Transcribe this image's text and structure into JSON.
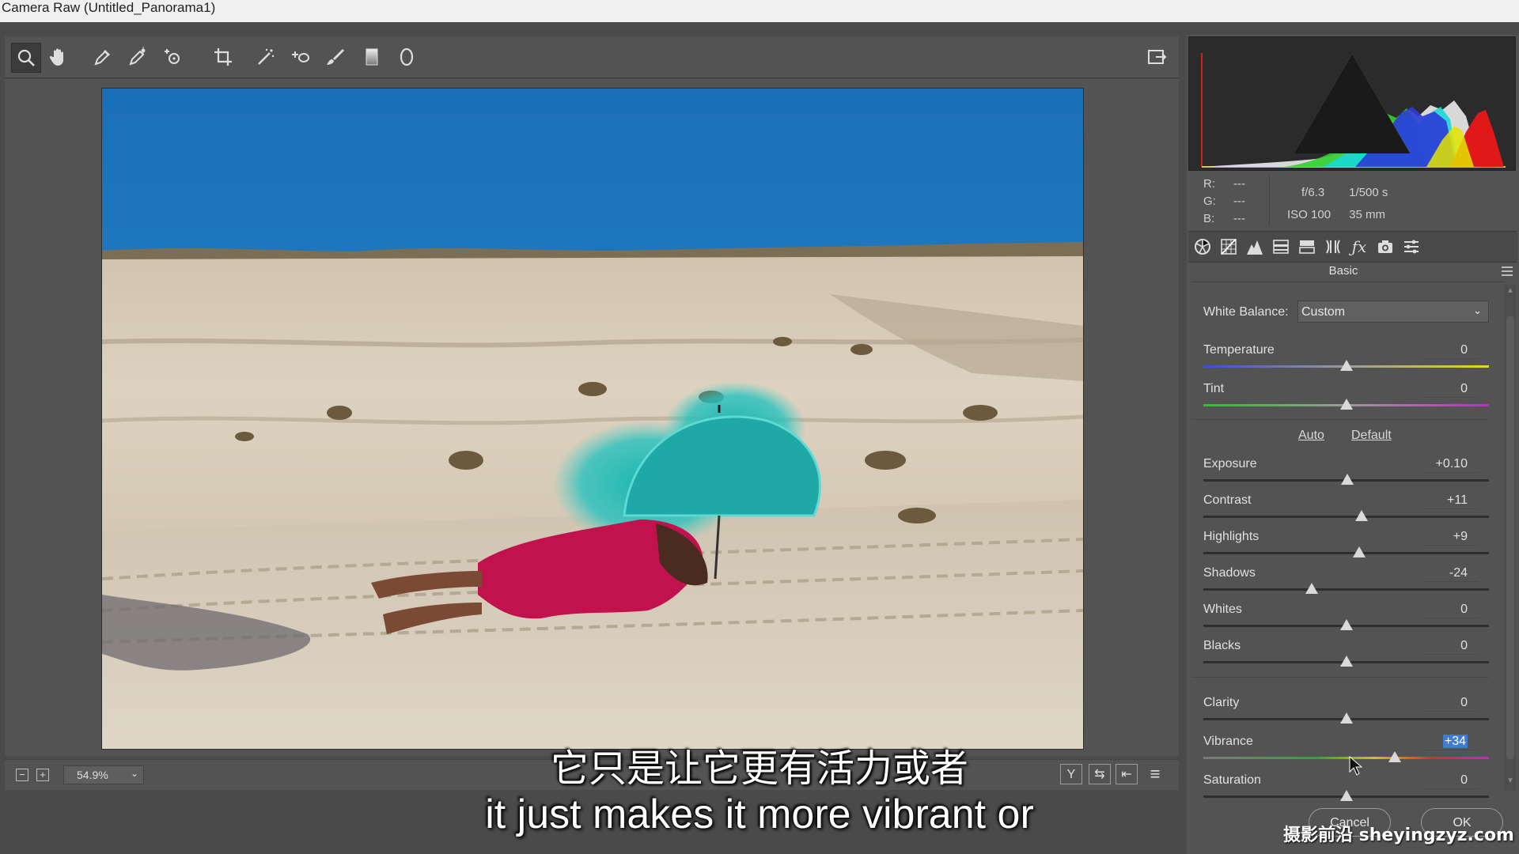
{
  "window": {
    "title": "Camera Raw (Untitled_Panorama1)"
  },
  "toolbar": {
    "tools": [
      {
        "name": "zoom-tool",
        "icon": "magnifier-icon"
      },
      {
        "name": "hand-tool",
        "icon": "hand-icon"
      },
      {
        "name": "white-balance-tool",
        "icon": "eyedropper-icon"
      },
      {
        "name": "color-sampler-tool",
        "icon": "color-sampler-icon"
      },
      {
        "name": "targeted-adjustment-tool",
        "icon": "target-adjust-icon"
      },
      {
        "name": "crop-tool",
        "icon": "crop-icon"
      },
      {
        "name": "straighten-tool",
        "icon": "straighten-icon"
      },
      {
        "name": "spot-removal-tool",
        "icon": "spot-removal-icon"
      },
      {
        "name": "adjustment-brush-tool",
        "icon": "brush-icon"
      },
      {
        "name": "graduated-filter-tool",
        "icon": "graduated-filter-icon"
      },
      {
        "name": "radial-filter-tool",
        "icon": "radial-filter-icon"
      }
    ],
    "export_icon": "open-export-icon"
  },
  "bottom_bar": {
    "zoom_value": "54.9%",
    "zoom_chevron": "⌄",
    "view_buttons": [
      "Y",
      "⇆",
      "⇤",
      "≡"
    ]
  },
  "readout": {
    "r_label": "R:",
    "r_value": "---",
    "g_label": "G:",
    "g_value": "---",
    "b_label": "B:",
    "b_value": "---",
    "aperture": "f/6.3",
    "shutter": "1/500 s",
    "iso": "ISO 100",
    "focal_length": "35 mm"
  },
  "panel": {
    "title": "Basic",
    "tabs": [
      "basic-icon",
      "tone-curve-icon",
      "detail-icon",
      "hsl-icon",
      "split-toning-icon",
      "lens-icon",
      "effects-icon",
      "camera-calibration-icon",
      "presets-icon"
    ],
    "white_balance_label": "White Balance:",
    "white_balance_value": "Custom",
    "auto_label": "Auto",
    "default_label": "Default",
    "sliders": [
      {
        "label": "Temperature",
        "value": "0",
        "pos": 0.5
      },
      {
        "label": "Tint",
        "value": "0",
        "pos": 0.5
      },
      {
        "label": "Exposure",
        "value": "+0.10",
        "pos": 0.505
      },
      {
        "label": "Contrast",
        "value": "+11",
        "pos": 0.555
      },
      {
        "label": "Highlights",
        "value": "+9",
        "pos": 0.545
      },
      {
        "label": "Shadows",
        "value": "-24",
        "pos": 0.38
      },
      {
        "label": "Whites",
        "value": "0",
        "pos": 0.5
      },
      {
        "label": "Blacks",
        "value": "0",
        "pos": 0.5
      },
      {
        "label": "Clarity",
        "value": "0",
        "pos": 0.5
      },
      {
        "label": "Vibrance",
        "value": "+34",
        "pos": 0.67
      },
      {
        "label": "Saturation",
        "value": "0",
        "pos": 0.5
      }
    ]
  },
  "footer": {
    "cancel_label": "Cancel",
    "ok_label": "OK"
  },
  "subtitles": {
    "chinese": "它只是让它更有活力或者",
    "english": "it just makes it more vibrant or"
  },
  "watermark": "摄影前沿 sheyingzyz.com",
  "colors": {
    "panel_bg": "#535353",
    "accent_highlight": "#3d7bd8",
    "sky": "#1f78c0"
  }
}
